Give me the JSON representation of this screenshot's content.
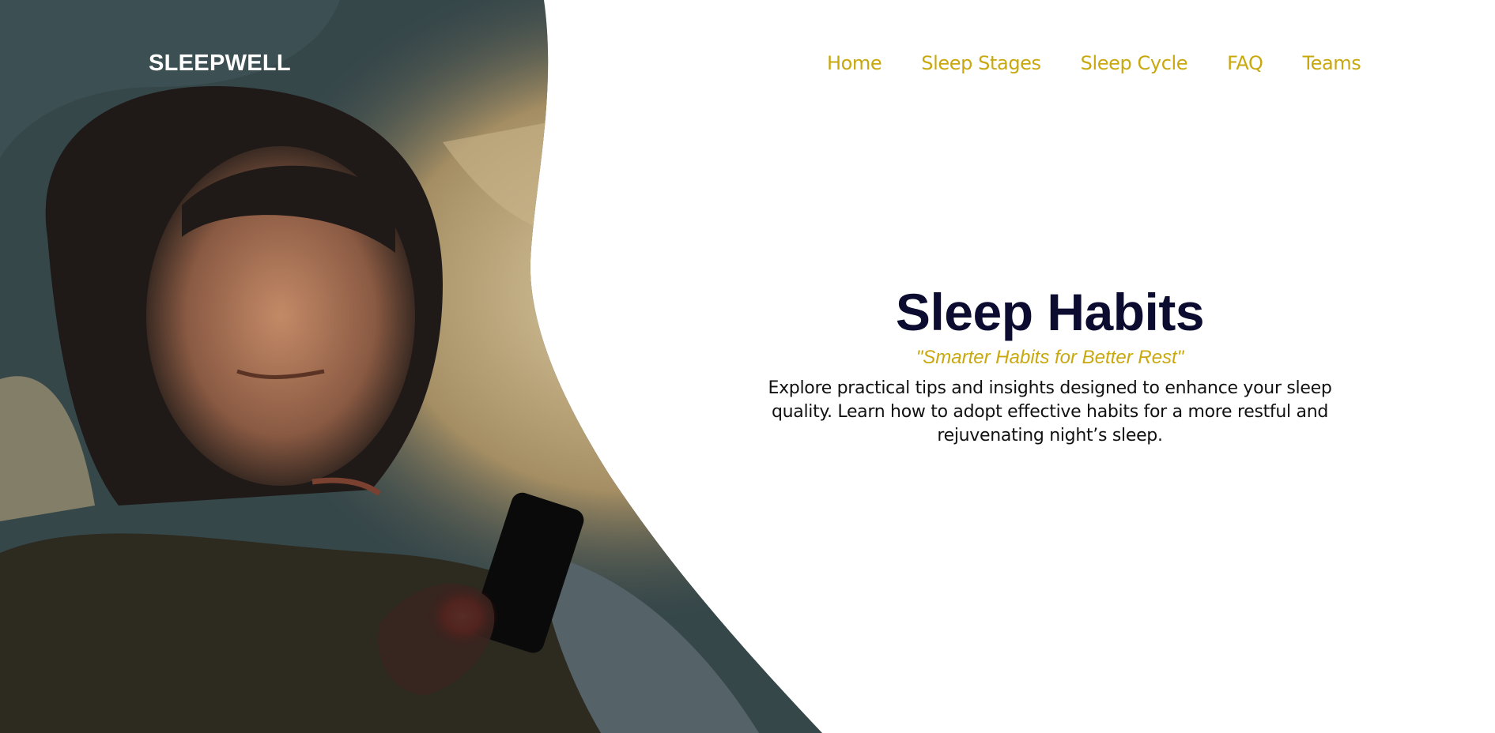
{
  "brand": {
    "name": "SLEEPWELL"
  },
  "nav": {
    "items": [
      {
        "label": "Home"
      },
      {
        "label": "Sleep Stages"
      },
      {
        "label": "Sleep Cycle"
      },
      {
        "label": "FAQ"
      },
      {
        "label": "Teams"
      }
    ]
  },
  "hero": {
    "title": "Sleep Habits",
    "tagline": "\"Smarter Habits for Better Rest\"",
    "description": "Explore practical tips and insights designed to enhance your sleep quality. Learn how to adopt effective habits for a more restful and rejuvenating night’s sleep."
  },
  "colors": {
    "accent": "#c9a80e",
    "title": "#0c0c30",
    "text": "#111111",
    "background": "#ffffff"
  },
  "image": {
    "subject": "woman-in-bed-using-phone-photo"
  }
}
